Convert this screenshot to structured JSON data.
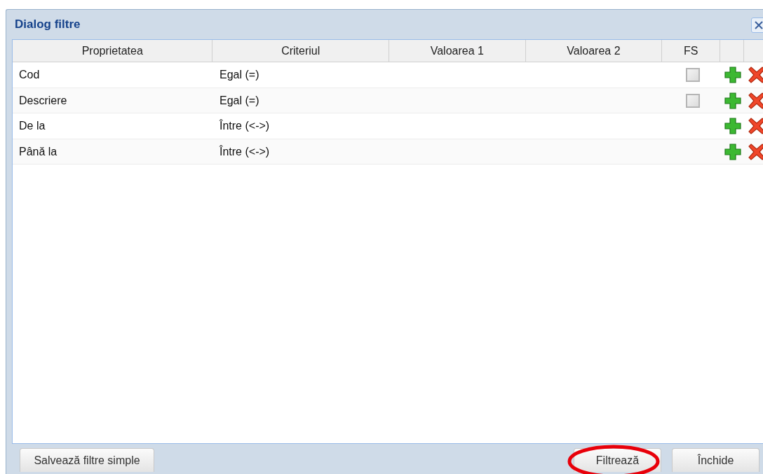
{
  "dialog": {
    "title": "Dialog filtre"
  },
  "table": {
    "columns": [
      "Proprietatea",
      "Criteriul",
      "Valoarea 1",
      "Valoarea 2",
      "FS"
    ],
    "rows": [
      {
        "property": "Cod",
        "criterion": "Egal (=)",
        "fs_checked": false
      },
      {
        "property": "Descriere",
        "criterion": "Egal (=)",
        "fs_checked": false
      },
      {
        "property": "De la",
        "criterion": "Între (<->)"
      },
      {
        "property": "Până la",
        "criterion": "Între (<->)"
      }
    ]
  },
  "buttons": [
    {
      "label": "Salvează filtre simple",
      "highlighted": false
    },
    {
      "label": "Filtrează",
      "highlighted": true
    },
    {
      "label": "Închide",
      "highlighted": false
    }
  ]
}
